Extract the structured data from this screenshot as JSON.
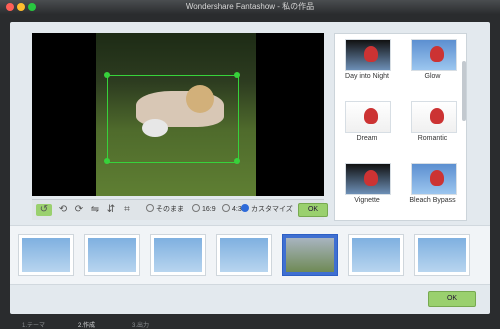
{
  "window": {
    "title": "Wondershare Fantashow - 私の作品"
  },
  "toolbar": {
    "aspect_options": [
      {
        "label": "そのまま",
        "selected": false
      },
      {
        "label": "16:9",
        "selected": false
      },
      {
        "label": "4:3",
        "selected": false
      },
      {
        "label": "カスタマイズ",
        "selected": true
      }
    ],
    "ok_label": "OK"
  },
  "effects": {
    "items": [
      {
        "label": "Day into Night"
      },
      {
        "label": "Glow"
      },
      {
        "label": "Dream"
      },
      {
        "label": "Romantic"
      },
      {
        "label": "Vignette"
      },
      {
        "label": "Bleach Bypass"
      }
    ]
  },
  "thumbnails": {
    "count": 7,
    "selected_index": 4
  },
  "dialog": {
    "ok_label": "OK"
  },
  "bottom_tabs": [
    {
      "label": "1.テーマ",
      "active": false
    },
    {
      "label": "2.作成",
      "active": true
    },
    {
      "label": "3.出力",
      "active": false
    }
  ],
  "colors": {
    "accent_green": "#9ad06e",
    "crop_green": "#37d23b",
    "selection_blue": "#3f6fd1"
  }
}
